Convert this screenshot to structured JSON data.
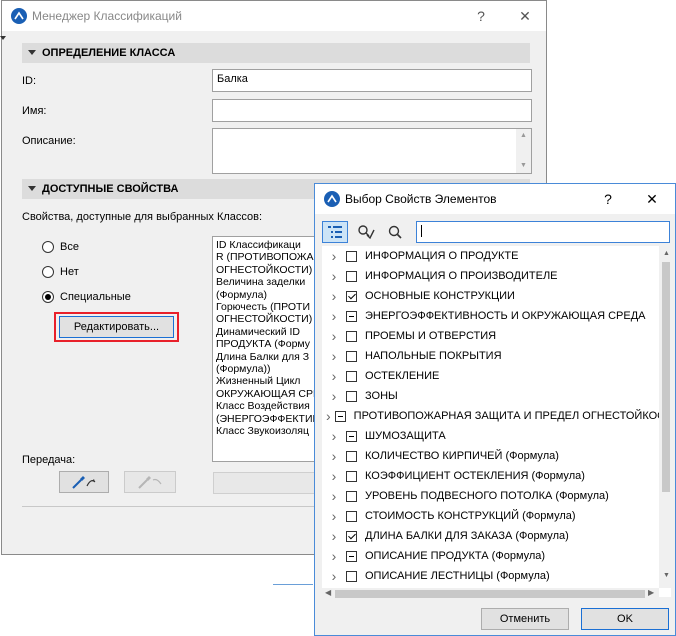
{
  "classification_manager": {
    "title": "Менеджер Классификаций",
    "help_label": "?",
    "close_label": "✕",
    "class_definition_header": "ОПРЕДЕЛЕНИЕ КЛАССА",
    "id_label": "ID:",
    "id_value": "Балка",
    "name_label": "Имя:",
    "name_value": "",
    "description_label": "Описание:",
    "description_value": "",
    "available_props_header": "ДОСТУПНЫЕ СВОЙСТВА",
    "available_props_text": "Свойства, доступные для выбранных Классов:",
    "radio_all": "Все",
    "radio_none": "Нет",
    "radio_special": "Специальные",
    "selected_radio": "special",
    "edit_button": "Редактировать...",
    "transfer_label": "Передача:",
    "props_list": [
      "ID Классификаци",
      "R (ПРОТИВОПОЖА",
      "ОГНЕСТОЙКОСТИ)",
      "Величина заделки",
      "(Формула)",
      "Горючесть (ПРОТИ",
      "ОГНЕСТОЙКОСТИ)",
      "Динамический ID",
      "ПРОДУКТА (Форму",
      "Длина Балки для З",
      "(Формула))",
      "Жизненный Цикл",
      "ОКРУЖАЮЩАЯ СРЕ",
      "Класс Воздействия",
      "(ЭНЕРГОЭФФЕКТИВ",
      "Класс Звукоизоляц"
    ]
  },
  "element_props": {
    "title": "Выбор Свойств Элементов",
    "help_label": "?",
    "close_label": "✕",
    "search_value": "",
    "cancel_button": "Отменить",
    "ok_button": "OK",
    "items": [
      {
        "label": "ИНФОРМАЦИЯ О ПРОДУКТЕ",
        "state": "unchecked"
      },
      {
        "label": "ИНФОРМАЦИЯ О ПРОИЗВОДИТЕЛЕ",
        "state": "unchecked"
      },
      {
        "label": "ОСНОВНЫЕ КОНСТРУКЦИИ",
        "state": "checked"
      },
      {
        "label": "ЭНЕРГОЭФФЕКТИВНОСТЬ И ОКРУЖАЮЩАЯ СРЕДА",
        "state": "partial"
      },
      {
        "label": "ПРОЕМЫ И ОТВЕРСТИЯ",
        "state": "unchecked"
      },
      {
        "label": "НАПОЛЬНЫЕ ПОКРЫТИЯ",
        "state": "unchecked"
      },
      {
        "label": "ОСТЕКЛЕНИЕ",
        "state": "unchecked"
      },
      {
        "label": "ЗОНЫ",
        "state": "unchecked"
      },
      {
        "label": "ПРОТИВОПОЖАРНАЯ ЗАЩИТА И ПРЕДЕЛ ОГНЕСТОЙКОСТ",
        "state": "partial"
      },
      {
        "label": "ШУМОЗАЩИТА",
        "state": "partial"
      },
      {
        "label": "КОЛИЧЕСТВО КИРПИЧЕЙ (Формула)",
        "state": "unchecked"
      },
      {
        "label": "КОЭФФИЦИЕНТ ОСТЕКЛЕНИЯ (Формула)",
        "state": "unchecked"
      },
      {
        "label": "УРОВЕНЬ ПОДВЕСНОГО ПОТОЛКА (Формула)",
        "state": "unchecked"
      },
      {
        "label": "СТОИМОСТЬ КОНСТРУКЦИЙ (Формула)",
        "state": "unchecked"
      },
      {
        "label": "ДЛИНА БАЛКИ ДЛЯ ЗАКАЗА (Формула)",
        "state": "checked"
      },
      {
        "label": "ОПИСАНИЕ ПРОДУКТА (Формула)",
        "state": "partial"
      },
      {
        "label": "ОПИСАНИЕ ЛЕСТНИЦЫ (Формула)",
        "state": "unchecked"
      }
    ]
  },
  "colors": {
    "highlight_border": "#e8202a",
    "accent": "#1a5fb4"
  }
}
